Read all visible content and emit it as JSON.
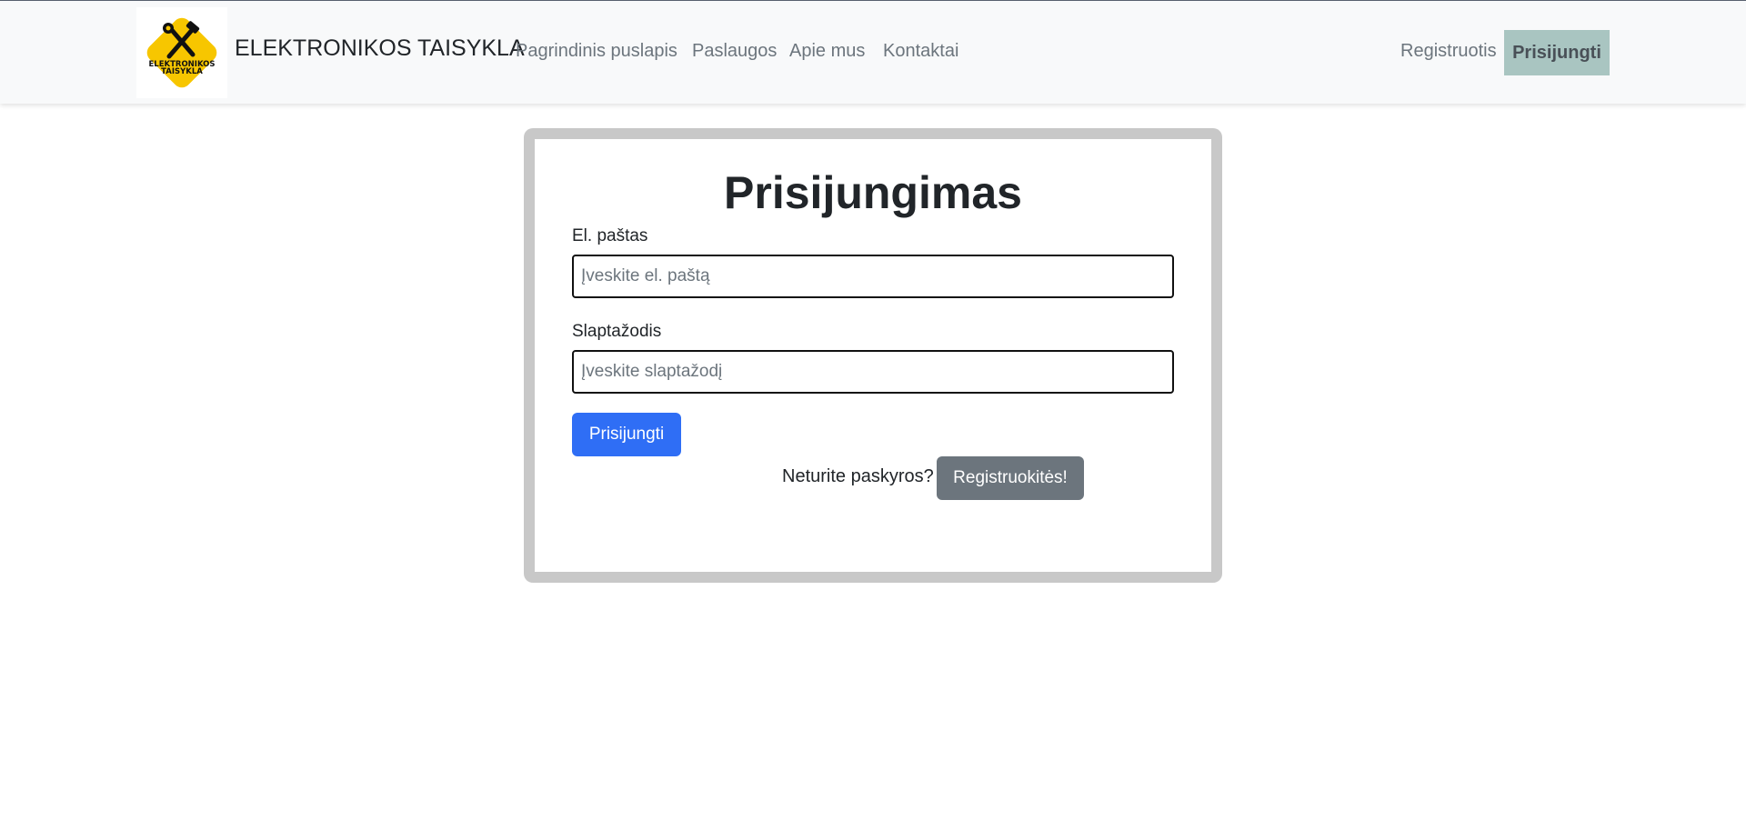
{
  "header": {
    "logo_text_line1": "ELEKTRONIKOS",
    "logo_text_line2": "TAISYKLA",
    "logo_icon": "wrench-hammer-icon",
    "brand": "ELEKTRONIKOS TAISYKLA",
    "nav": [
      {
        "label": "Pagrindinis puslapis"
      },
      {
        "label": "Paslaugos"
      },
      {
        "label": "Apie mus"
      },
      {
        "label": "Kontaktai"
      }
    ],
    "register_label": "Registruotis",
    "login_label": "Prisijungti"
  },
  "login_form": {
    "title": "Prisijungimas",
    "email_label": "El. paštas",
    "email_placeholder": "Įveskite el. paštą",
    "email_value": "",
    "password_label": "Slaptažodis",
    "password_placeholder": "Įveskite slaptažodį",
    "password_value": "",
    "submit_label": "Prisijungti",
    "no_account_text": "Neturite paskyros?",
    "register_button_label": "Registruokitės!"
  },
  "colors": {
    "primary": "#2f6ef5",
    "secondary": "#6c757d",
    "active_nav_bg": "#a9c5c1",
    "logo_yellow": "#f7c600"
  }
}
